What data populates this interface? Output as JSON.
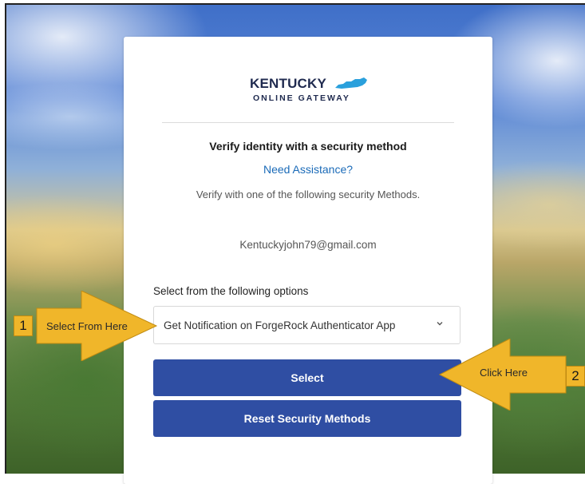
{
  "logo": {
    "top": "KENTUCKY",
    "bottom": "ONLINE GATEWAY"
  },
  "page": {
    "heading": "Verify identity with a security method",
    "assistance_link": "Need Assistance?",
    "subtext": "Verify with one of the following security Methods.",
    "email": "Kentuckyjohn79@gmail.com",
    "options_label": "Select from the following options",
    "selected_option": "Get Notification on ForgeRock Authenticator App",
    "select_button": "Select",
    "reset_button": "Reset Security Methods"
  },
  "annotations": {
    "step1_number": "1",
    "step1_text": "Select From Here",
    "step2_number": "2",
    "step2_text": "Click Here"
  },
  "colors": {
    "button_bg": "#2f4ea3",
    "link": "#1b6bb8",
    "annotation": "#f0b62a",
    "logo_text": "#1f2a4f"
  }
}
